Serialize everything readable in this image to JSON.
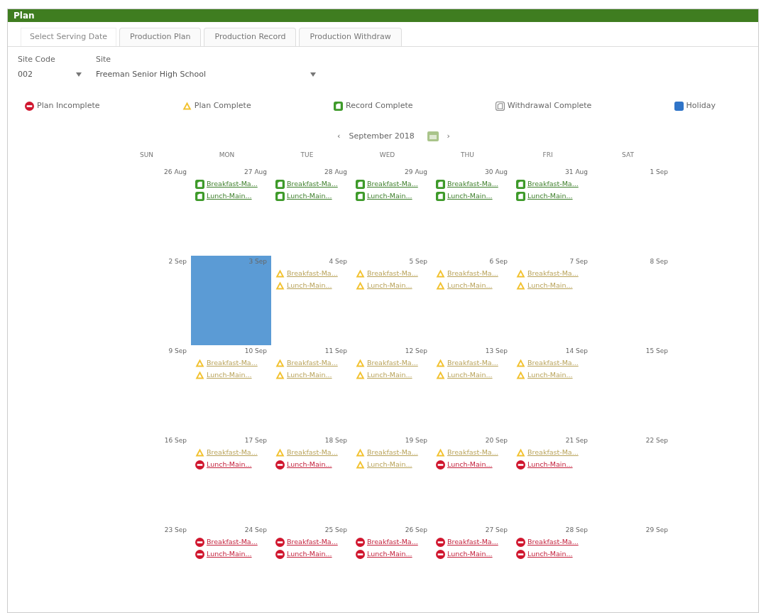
{
  "window": {
    "title": "Plan"
  },
  "tabs": [
    {
      "label": "Select Serving Date",
      "selected": true
    },
    {
      "label": "Production Plan",
      "selected": false
    },
    {
      "label": "Production Record",
      "selected": false
    },
    {
      "label": "Production Withdraw",
      "selected": false
    }
  ],
  "filters": [
    {
      "label": "Site Code",
      "value": "002"
    },
    {
      "label": "Site",
      "value": "Freeman Senior High School"
    }
  ],
  "legend": [
    {
      "kind": "plan_incomplete",
      "label": "Plan Incomplete"
    },
    {
      "kind": "plan_complete",
      "label": "Plan Complete"
    },
    {
      "kind": "record_complete",
      "label": "Record Complete"
    },
    {
      "kind": "withdrawal_complete",
      "label": "Withdrawal Complete"
    },
    {
      "kind": "holiday",
      "label": "Holiday"
    }
  ],
  "calendar": {
    "prev": "‹",
    "month": "September 2018",
    "next": "›",
    "weekdays": [
      "SUN",
      "MON",
      "TUE",
      "WED",
      "THU",
      "FRI",
      "SAT"
    ],
    "weeks": [
      [
        {
          "date": "26 Aug",
          "holiday": false
        },
        {
          "date": "27 Aug",
          "holiday": false,
          "entries": [
            {
              "kind": "record_complete",
              "label": "Breakfast-Ma..."
            },
            {
              "kind": "record_complete",
              "label": "Lunch-Main..."
            }
          ]
        },
        {
          "date": "28 Aug",
          "holiday": false,
          "entries": [
            {
              "kind": "record_complete",
              "label": "Breakfast-Ma..."
            },
            {
              "kind": "record_complete",
              "label": "Lunch-Main..."
            }
          ]
        },
        {
          "date": "29 Aug",
          "holiday": false,
          "entries": [
            {
              "kind": "record_complete",
              "label": "Breakfast-Ma..."
            },
            {
              "kind": "record_complete",
              "label": "Lunch-Main..."
            }
          ]
        },
        {
          "date": "30 Aug",
          "holiday": false,
          "entries": [
            {
              "kind": "record_complete",
              "label": "Breakfast-Ma..."
            },
            {
              "kind": "record_complete",
              "label": "Lunch-Main..."
            }
          ]
        },
        {
          "date": "31 Aug",
          "holiday": false,
          "entries": [
            {
              "kind": "record_complete",
              "label": "Breakfast-Ma..."
            },
            {
              "kind": "record_complete",
              "label": "Lunch-Main..."
            }
          ]
        },
        {
          "date": "1 Sep",
          "holiday": false
        }
      ],
      [
        {
          "date": "2 Sep",
          "holiday": false
        },
        {
          "date": "3 Sep",
          "holiday": true
        },
        {
          "date": "4 Sep",
          "holiday": false,
          "entries": [
            {
              "kind": "plan_complete",
              "label": "Breakfast-Ma..."
            },
            {
              "kind": "plan_complete",
              "label": "Lunch-Main..."
            }
          ]
        },
        {
          "date": "5 Sep",
          "holiday": false,
          "entries": [
            {
              "kind": "plan_complete",
              "label": "Breakfast-Ma..."
            },
            {
              "kind": "plan_complete",
              "label": "Lunch-Main..."
            }
          ]
        },
        {
          "date": "6 Sep",
          "holiday": false,
          "entries": [
            {
              "kind": "plan_complete",
              "label": "Breakfast-Ma..."
            },
            {
              "kind": "plan_complete",
              "label": "Lunch-Main..."
            }
          ]
        },
        {
          "date": "7 Sep",
          "holiday": false,
          "entries": [
            {
              "kind": "plan_complete",
              "label": "Breakfast-Ma..."
            },
            {
              "kind": "plan_complete",
              "label": "Lunch-Main..."
            }
          ]
        },
        {
          "date": "8 Sep",
          "holiday": false
        }
      ],
      [
        {
          "date": "9 Sep",
          "holiday": false
        },
        {
          "date": "10 Sep",
          "holiday": false,
          "entries": [
            {
              "kind": "plan_complete",
              "label": "Breakfast-Ma..."
            },
            {
              "kind": "plan_complete",
              "label": "Lunch-Main..."
            }
          ]
        },
        {
          "date": "11 Sep",
          "holiday": false,
          "entries": [
            {
              "kind": "plan_complete",
              "label": "Breakfast-Ma..."
            },
            {
              "kind": "plan_complete",
              "label": "Lunch-Main..."
            }
          ]
        },
        {
          "date": "12 Sep",
          "holiday": false,
          "entries": [
            {
              "kind": "plan_complete",
              "label": "Breakfast-Ma..."
            },
            {
              "kind": "plan_complete",
              "label": "Lunch-Main..."
            }
          ]
        },
        {
          "date": "13 Sep",
          "holiday": false,
          "entries": [
            {
              "kind": "plan_complete",
              "label": "Breakfast-Ma..."
            },
            {
              "kind": "plan_complete",
              "label": "Lunch-Main..."
            }
          ]
        },
        {
          "date": "14 Sep",
          "holiday": false,
          "entries": [
            {
              "kind": "plan_complete",
              "label": "Breakfast-Ma..."
            },
            {
              "kind": "plan_complete",
              "label": "Lunch-Main..."
            }
          ]
        },
        {
          "date": "15 Sep",
          "holiday": false
        }
      ],
      [
        {
          "date": "16 Sep",
          "holiday": false
        },
        {
          "date": "17 Sep",
          "holiday": false,
          "entries": [
            {
              "kind": "plan_complete",
              "label": "Breakfast-Ma..."
            },
            {
              "kind": "plan_incomplete",
              "label": "Lunch-Main..."
            }
          ]
        },
        {
          "date": "18 Sep",
          "holiday": false,
          "entries": [
            {
              "kind": "plan_complete",
              "label": "Breakfast-Ma..."
            },
            {
              "kind": "plan_incomplete",
              "label": "Lunch-Main..."
            }
          ]
        },
        {
          "date": "19 Sep",
          "holiday": false,
          "entries": [
            {
              "kind": "plan_complete",
              "label": "Breakfast-Ma..."
            },
            {
              "kind": "plan_complete",
              "label": "Lunch-Main..."
            }
          ]
        },
        {
          "date": "20 Sep",
          "holiday": false,
          "entries": [
            {
              "kind": "plan_complete",
              "label": "Breakfast-Ma..."
            },
            {
              "kind": "plan_incomplete",
              "label": "Lunch-Main..."
            }
          ]
        },
        {
          "date": "21 Sep",
          "holiday": false,
          "entries": [
            {
              "kind": "plan_complete",
              "label": "Breakfast-Ma..."
            },
            {
              "kind": "plan_incomplete",
              "label": "Lunch-Main..."
            }
          ]
        },
        {
          "date": "22 Sep",
          "holiday": false
        }
      ],
      [
        {
          "date": "23 Sep",
          "holiday": false
        },
        {
          "date": "24 Sep",
          "holiday": false,
          "entries": [
            {
              "kind": "plan_incomplete",
              "label": "Breakfast-Ma..."
            },
            {
              "kind": "plan_incomplete",
              "label": "Lunch-Main..."
            }
          ]
        },
        {
          "date": "25 Sep",
          "holiday": false,
          "entries": [
            {
              "kind": "plan_incomplete",
              "label": "Breakfast-Ma..."
            },
            {
              "kind": "plan_incomplete",
              "label": "Lunch-Main..."
            }
          ]
        },
        {
          "date": "26 Sep",
          "holiday": false,
          "entries": [
            {
              "kind": "plan_incomplete",
              "label": "Breakfast-Ma..."
            },
            {
              "kind": "plan_incomplete",
              "label": "Lunch-Main..."
            }
          ]
        },
        {
          "date": "27 Sep",
          "holiday": false,
          "entries": [
            {
              "kind": "plan_incomplete",
              "label": "Breakfast-Ma..."
            },
            {
              "kind": "plan_incomplete",
              "label": "Lunch-Main..."
            }
          ]
        },
        {
          "date": "28 Sep",
          "holiday": false,
          "entries": [
            {
              "kind": "plan_incomplete",
              "label": "Breakfast-Ma..."
            },
            {
              "kind": "plan_incomplete",
              "label": "Lunch-Main..."
            }
          ]
        },
        {
          "date": "29 Sep",
          "holiday": false
        }
      ]
    ]
  }
}
